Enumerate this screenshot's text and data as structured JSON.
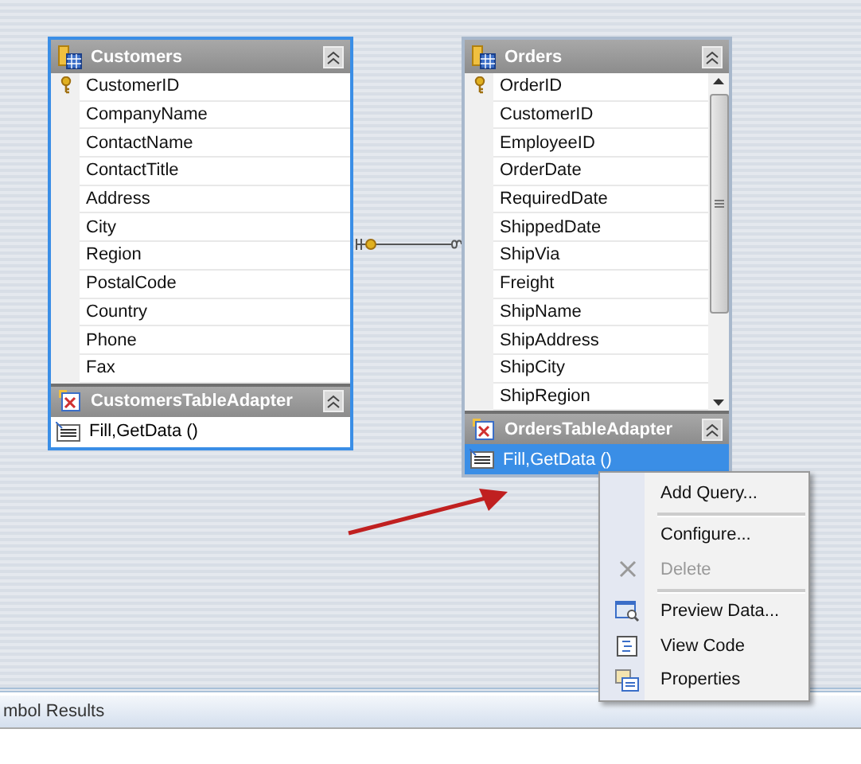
{
  "tables": [
    {
      "title": "Customers",
      "scrollable": false,
      "selected": true,
      "columns": [
        {
          "name": "CustomerID",
          "primary_key": true
        },
        {
          "name": "CompanyName",
          "primary_key": false
        },
        {
          "name": "ContactName",
          "primary_key": false
        },
        {
          "name": "ContactTitle",
          "primary_key": false
        },
        {
          "name": "Address",
          "primary_key": false
        },
        {
          "name": "City",
          "primary_key": false
        },
        {
          "name": "Region",
          "primary_key": false
        },
        {
          "name": "PostalCode",
          "primary_key": false
        },
        {
          "name": "Country",
          "primary_key": false
        },
        {
          "name": "Phone",
          "primary_key": false
        },
        {
          "name": "Fax",
          "primary_key": false
        }
      ],
      "adapter": {
        "title": "CustomersTableAdapter",
        "methods": [
          {
            "label": "Fill,GetData ()",
            "selected": false
          }
        ]
      }
    },
    {
      "title": "Orders",
      "scrollable": true,
      "selected": false,
      "columns": [
        {
          "name": "OrderID",
          "primary_key": true
        },
        {
          "name": "CustomerID",
          "primary_key": false
        },
        {
          "name": "EmployeeID",
          "primary_key": false
        },
        {
          "name": "OrderDate",
          "primary_key": false
        },
        {
          "name": "RequiredDate",
          "primary_key": false
        },
        {
          "name": "ShippedDate",
          "primary_key": false
        },
        {
          "name": "ShipVia",
          "primary_key": false
        },
        {
          "name": "Freight",
          "primary_key": false
        },
        {
          "name": "ShipName",
          "primary_key": false
        },
        {
          "name": "ShipAddress",
          "primary_key": false
        },
        {
          "name": "ShipCity",
          "primary_key": false
        },
        {
          "name": "ShipRegion",
          "primary_key": false
        }
      ],
      "adapter": {
        "title": "OrdersTableAdapter",
        "methods": [
          {
            "label": "Fill,GetData ()",
            "selected": true
          }
        ]
      }
    }
  ],
  "context_menu": [
    {
      "kind": "item",
      "label": "Add Query...",
      "disabled": false
    },
    {
      "kind": "separator"
    },
    {
      "kind": "item",
      "label": "Configure...",
      "disabled": false
    },
    {
      "kind": "item",
      "label": "Delete",
      "disabled": true
    },
    {
      "kind": "separator"
    },
    {
      "kind": "item",
      "label": "Preview Data...",
      "disabled": false
    },
    {
      "kind": "item",
      "label": "View Code",
      "disabled": false
    },
    {
      "kind": "item",
      "label": "Properties",
      "disabled": false
    }
  ],
  "bottom_panel": {
    "tab": "mbol Results"
  }
}
